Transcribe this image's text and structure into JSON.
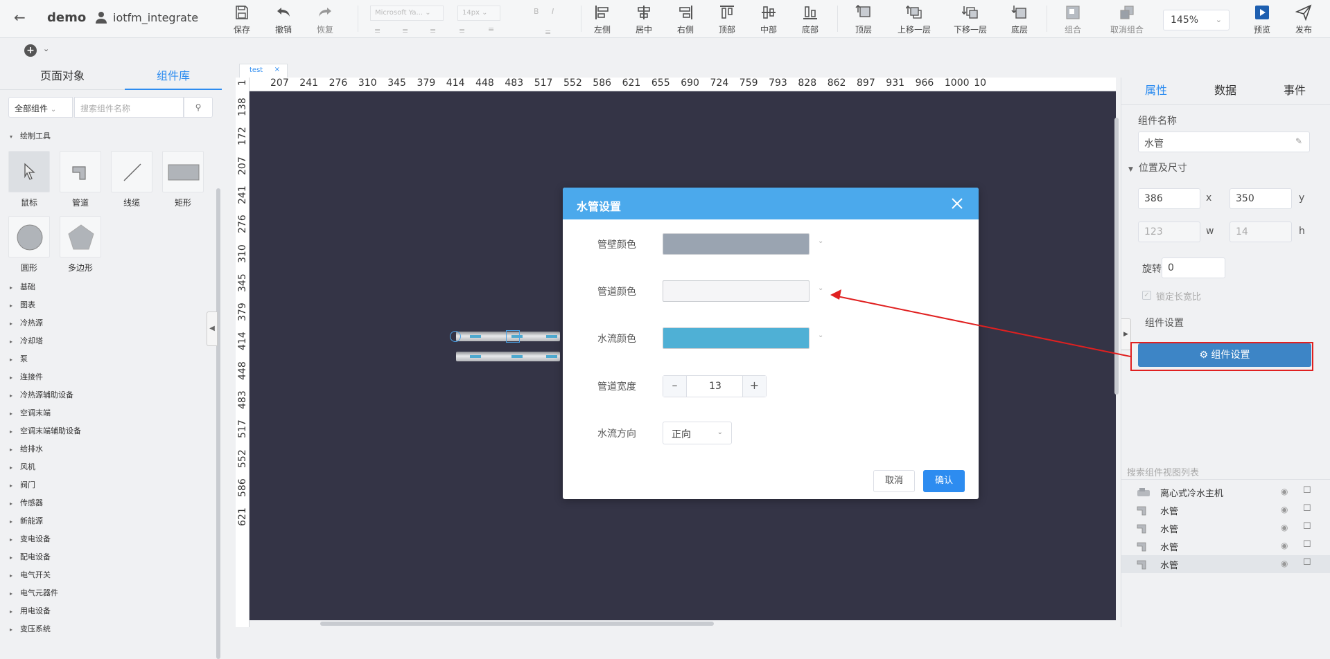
{
  "app": {
    "name": "demo",
    "user": "iotfm_integrate"
  },
  "toolbar": {
    "save": "保存",
    "undo": "撤销",
    "redo": "恢复",
    "font_family": "Microsoft Ya...",
    "font_size": "14px",
    "align_left": "左侧",
    "align_center": "居中",
    "align_right": "右侧",
    "align_top": "顶部",
    "align_middle": "中部",
    "align_bottom": "底部",
    "to_top": "顶层",
    "move_up": "上移一层",
    "move_down": "下移一层",
    "to_bottom": "底层",
    "group": "组合",
    "ungroup": "取消组合",
    "zoom": "145%",
    "preview": "预览",
    "publish": "发布"
  },
  "left_panel": {
    "tabs": [
      "页面对象",
      "组件库"
    ],
    "filter": "全部组件",
    "search_placeholder": "搜索组件名称",
    "draw_tools_title": "绘制工具",
    "tools": [
      "鼠标",
      "管道",
      "线缆",
      "矩形",
      "圆形",
      "多边形"
    ],
    "categories": [
      "基础",
      "图表",
      "冷热源",
      "冷却塔",
      "泵",
      "连接件",
      "冷热源辅助设备",
      "空调末端",
      "空调末端辅助设备",
      "给排水",
      "风机",
      "阀门",
      "传感器",
      "新能源",
      "变电设备",
      "配电设备",
      "电气开关",
      "电气元器件",
      "用电设备",
      "变压系统"
    ]
  },
  "canvas": {
    "tab": "test",
    "h_ruler": [
      "2",
      "207",
      "241",
      "276",
      "310",
      "345",
      "379",
      "414",
      "448",
      "483",
      "517",
      "552",
      "586",
      "621",
      "655",
      "690",
      "724",
      "759",
      "793",
      "828",
      "862",
      "897",
      "931",
      "966",
      "1000",
      "10"
    ],
    "v_ruler": [
      "1",
      "138",
      "172",
      "207",
      "241",
      "276",
      "310",
      "345",
      "379",
      "414",
      "448",
      "483",
      "517",
      "552",
      "586",
      "621"
    ]
  },
  "right_panel": {
    "tabs": [
      "属性",
      "数据",
      "事件"
    ],
    "name_label": "组件名称",
    "name_value": "水管",
    "pos_section": "位置及尺寸",
    "x": "386",
    "x_label": "x",
    "y": "350",
    "y_label": "y",
    "w": "123",
    "w_label": "w",
    "h": "14",
    "h_label": "h",
    "rotate_label": "旋转",
    "rotate": "0",
    "lock_ratio": "锁定长宽比",
    "settings_label": "组件设置",
    "settings_button": "组件设置",
    "layer_search_placeholder": "搜索组件视图列表",
    "layers": [
      "离心式冷水主机",
      "水管",
      "水管",
      "水管",
      "水管"
    ]
  },
  "modal": {
    "title": "水管设置",
    "wall_color_label": "管壁颜色",
    "wall_color": "#9aa4b1",
    "pipe_color_label": "管道颜色",
    "pipe_color": "#f5f5f7",
    "flow_color_label": "水流颜色",
    "flow_color": "#4fb0d5",
    "width_label": "管道宽度",
    "width_value": "13",
    "direction_label": "水流方向",
    "direction_value": "正向",
    "cancel": "取消",
    "confirm": "确认"
  }
}
